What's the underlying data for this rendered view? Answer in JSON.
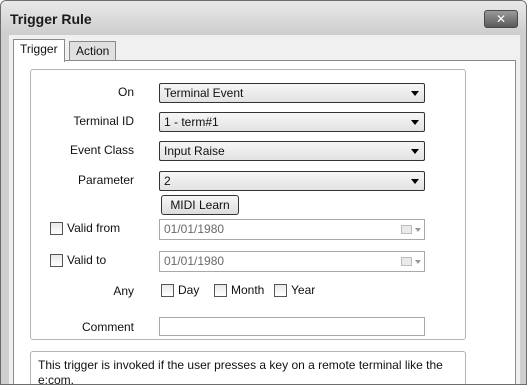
{
  "window": {
    "title": "Trigger Rule",
    "close_glyph": "✕"
  },
  "tabs": [
    {
      "label": "Trigger",
      "active": true
    },
    {
      "label": "Action",
      "active": false
    }
  ],
  "form": {
    "on": {
      "label": "On",
      "value": "Terminal Event"
    },
    "terminal_id": {
      "label": "Terminal ID",
      "value": "1 - term#1"
    },
    "event_class": {
      "label": "Event Class",
      "value": "Input Raise"
    },
    "parameter": {
      "label": "Parameter",
      "value": "2"
    },
    "midi_learn_label": "MIDI Learn",
    "valid_from": {
      "label": "Valid from",
      "checked": false,
      "value": "01/01/1980"
    },
    "valid_to": {
      "label": "Valid to",
      "checked": false,
      "value": "01/01/1980"
    },
    "any": {
      "label": "Any",
      "options": [
        {
          "label": "Day",
          "checked": false
        },
        {
          "label": "Month",
          "checked": false
        },
        {
          "label": "Year",
          "checked": false
        }
      ]
    },
    "comment": {
      "label": "Comment",
      "value": ""
    }
  },
  "description": "This trigger is invoked if the user presses a key on a remote terminal like the e:com.",
  "icons": {
    "close": "close-icon",
    "dropdown": "chevron-down-icon",
    "calendar": "calendar-icon"
  }
}
